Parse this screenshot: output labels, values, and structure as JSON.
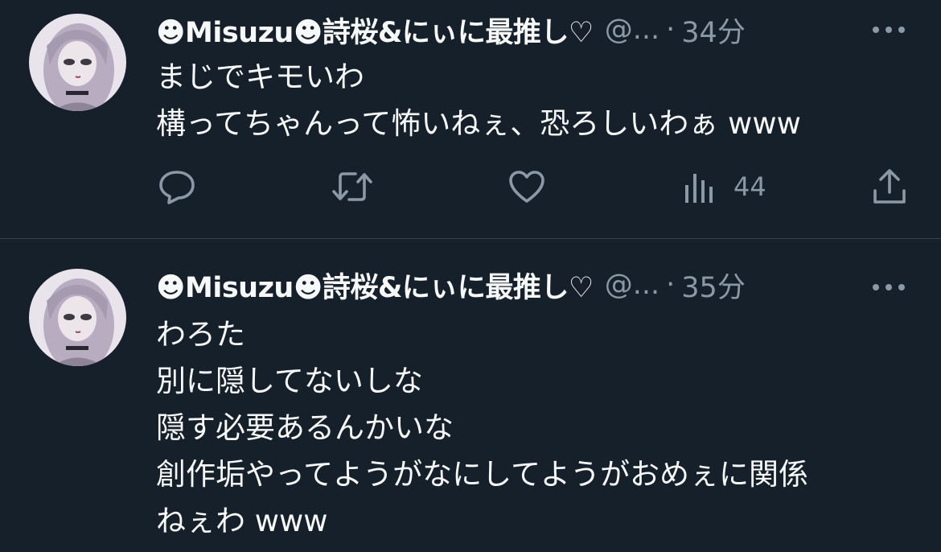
{
  "theme": {
    "background": "#15202b",
    "divider": "#38444d",
    "text_primary": "#f7f9f9",
    "text_secondary": "#8b98a5"
  },
  "tweets": [
    {
      "display_name": "☻Misuzu☻詩桜&にぃに最推し♡",
      "handle": "@...",
      "separator": "·",
      "time": "34分",
      "more_icon": "more-horizontal-icon",
      "text_lines": [
        "まじでキモいわ",
        "構ってちゃんって怖いねぇ、恐ろしいわぁ www"
      ],
      "actions": {
        "reply_icon": "reply-icon",
        "retweet_icon": "retweet-icon",
        "like_icon": "heart-icon",
        "views_icon": "views-icon",
        "views_count": "44",
        "share_icon": "share-icon"
      }
    },
    {
      "display_name": "☻Misuzu☻詩桜&にぃに最推し♡",
      "handle": "@...",
      "separator": "·",
      "time": "35分",
      "more_icon": "more-horizontal-icon",
      "text_lines": [
        "わろた",
        "別に隠してないしな",
        "隠す必要あるんかいな",
        "創作垢やってようがなにしてようがおめぇに関係",
        "ねぇわ www"
      ]
    }
  ]
}
